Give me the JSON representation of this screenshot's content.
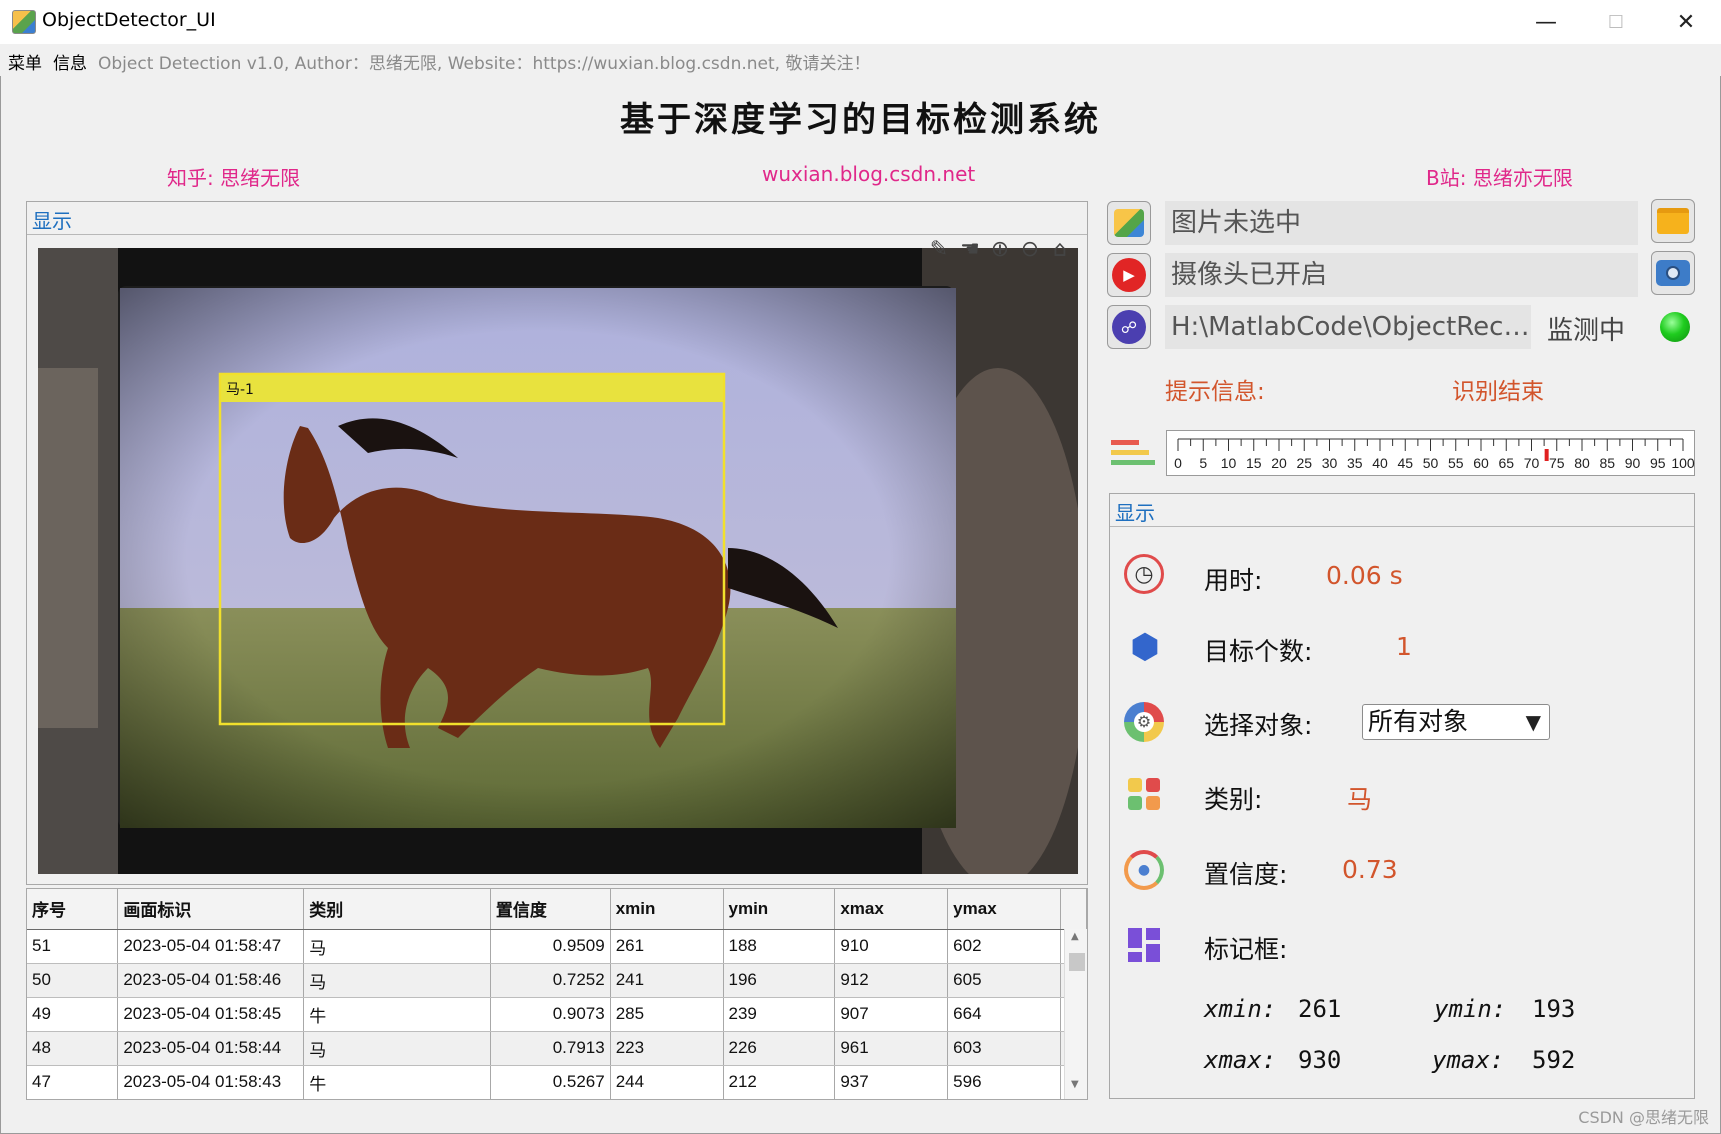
{
  "window": {
    "title": "ObjectDetector_UI",
    "min": "—",
    "max": "☐",
    "close": "✕"
  },
  "menu": {
    "items": [
      "菜单",
      "信息"
    ],
    "info": "Object Detection v1.0, Author：思绪无限, Website：https://wuxian.blog.csdn.net, 敬请关注！"
  },
  "header": {
    "title": "基于深度学习的目标检测系统",
    "zhihu": "知乎: 思绪无限",
    "site": "wuxian.blog.csdn.net",
    "bilibili": "B站: 思绪亦无限"
  },
  "display_panel": {
    "title": "显示",
    "box_label": "马-1"
  },
  "table": {
    "headers": [
      "序号",
      "画面标识",
      "类别",
      "置信度",
      "xmin",
      "ymin",
      "xmax",
      "ymax"
    ],
    "rows": [
      [
        "51",
        "2023-05-04 01:58:47",
        "马",
        "0.9509",
        "261",
        "188",
        "910",
        "602"
      ],
      [
        "50",
        "2023-05-04 01:58:46",
        "马",
        "0.7252",
        "241",
        "196",
        "912",
        "605"
      ],
      [
        "49",
        "2023-05-04 01:58:45",
        "牛",
        "0.9073",
        "285",
        "239",
        "907",
        "664"
      ],
      [
        "48",
        "2023-05-04 01:58:44",
        "马",
        "0.7913",
        "223",
        "226",
        "961",
        "603"
      ],
      [
        "47",
        "2023-05-04 01:58:43",
        "牛",
        "0.5267",
        "244",
        "212",
        "937",
        "596"
      ]
    ]
  },
  "controls": {
    "image_field": "图片未选中",
    "camera_field": "摄像头已开启",
    "model_field": "H:\\MatlabCode\\ObjectReco…",
    "monitor_label": "监测中",
    "hint_label": "提示信息:",
    "hint_value": "识别结束"
  },
  "slider": {
    "ticks": [
      "0",
      "5",
      "10",
      "15",
      "20",
      "25",
      "30",
      "35",
      "40",
      "45",
      "50",
      "55",
      "60",
      "65",
      "70",
      "75",
      "80",
      "85",
      "90",
      "95",
      "100"
    ],
    "value": 73,
    "min": 0,
    "max": 100
  },
  "result_panel": {
    "title": "显示",
    "time_label": "用时:",
    "time_value": "0.06 s",
    "count_label": "目标个数:",
    "count_value": "1",
    "select_label": "选择对象:",
    "select_value": "所有对象",
    "class_label": "类别:",
    "class_value": "马",
    "conf_label": "置信度:",
    "conf_value": "0.73",
    "box_label": "标记框:",
    "xmin_label": "xmin:",
    "xmin_value": "261",
    "ymin_label": "ymin:",
    "ymin_value": "193",
    "xmax_label": "xmax:",
    "xmax_value": "930",
    "ymax_label": "ymax:",
    "ymax_value": "592"
  },
  "colors": {
    "accent_pink": "#e0288a",
    "result_orange": "#d2552c",
    "panel_title_blue": "#1e6fbf",
    "status_green": "#1fcc1f"
  },
  "watermark": "CSDN @思绪无限"
}
